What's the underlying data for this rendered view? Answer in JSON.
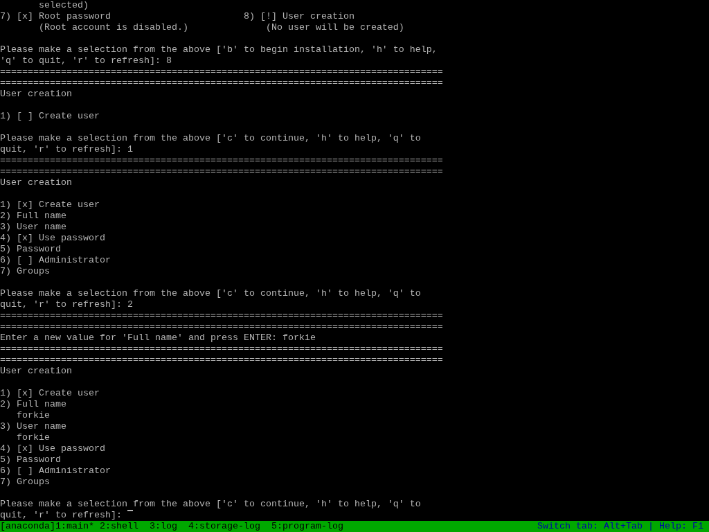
{
  "terminal": {
    "blocks": [
      [
        "       selected)",
        "7) [x] Root password                        8) [!] User creation",
        "       (Root account is disabled.)              (No user will be created)"
      ],
      [
        "Please make a selection from the above ['b' to begin installation, 'h' to help,",
        "'q' to quit, 'r' to refresh]: 8",
        "================================================================================",
        "================================================================================",
        "User creation"
      ],
      [
        "1) [ ] Create user"
      ],
      [
        "Please make a selection from the above ['c' to continue, 'h' to help, 'q' to",
        "quit, 'r' to refresh]: 1",
        "================================================================================",
        "================================================================================",
        "User creation"
      ],
      [
        "1) [x] Create user",
        "2) Full name",
        "3) User name",
        "4) [x] Use password",
        "5) Password",
        "6) [ ] Administrator",
        "7) Groups"
      ],
      [
        "Please make a selection from the above ['c' to continue, 'h' to help, 'q' to",
        "quit, 'r' to refresh]: 2",
        "================================================================================",
        "================================================================================",
        "Enter a new value for 'Full name' and press ENTER: forkie",
        "================================================================================",
        "================================================================================",
        "User creation"
      ],
      [
        "1) [x] Create user",
        "2) Full name",
        "   forkie",
        "3) User name",
        "   forkie",
        "4) [x] Use password",
        "5) Password",
        "6) [ ] Administrator",
        "7) Groups"
      ],
      [
        "Please make a selection from the above ['c' to continue, 'h' to help, 'q' to",
        "quit, 'r' to refresh]: "
      ]
    ]
  },
  "status_bar": {
    "session": "[anaconda]",
    "tabs": [
      "1:main*",
      "2:shell",
      "3:log",
      "4:storage-log",
      "5:program-log"
    ],
    "hint": "Switch tab: Alt+Tab | Help: F1"
  }
}
